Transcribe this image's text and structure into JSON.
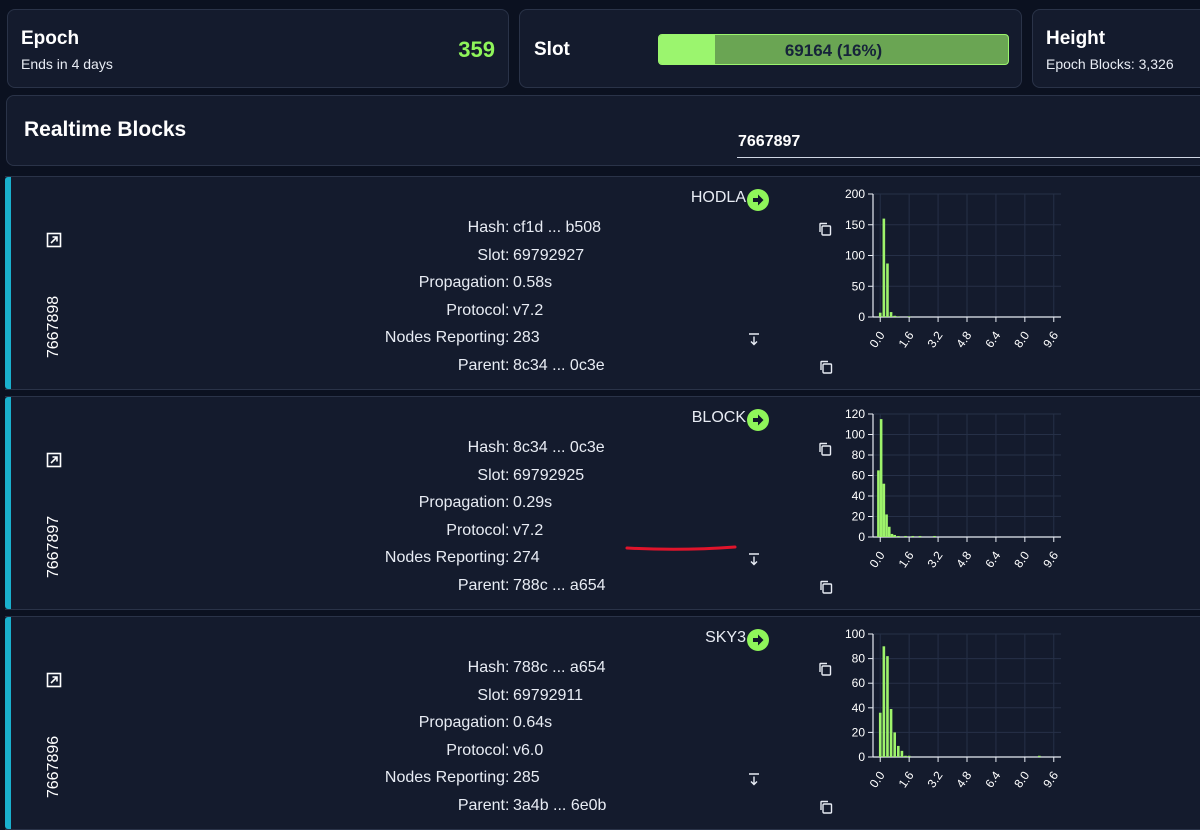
{
  "epoch": {
    "title": "Epoch",
    "subtitle": "Ends in 4 days",
    "value": "359"
  },
  "slot": {
    "title": "Slot",
    "text": "69164 (16%)",
    "progress": 0.16
  },
  "height": {
    "title": "Height",
    "subtitle": "Epoch Blocks: 3,326"
  },
  "realtime": {
    "title": "Realtime Blocks",
    "search_value": "7667897"
  },
  "labels": {
    "hash": "Hash",
    "slot": "Slot",
    "propagation": "Propagation",
    "protocol": "Protocol",
    "nodes": "Nodes Reporting",
    "parent": "Parent",
    "colon": ":"
  },
  "colors": {
    "accent": "#1ab0cd",
    "green": "#8ff55a",
    "bar": "#9ef36b",
    "underline": "#e0142b"
  },
  "icons": {
    "external": "external-link-icon",
    "arrow": "arrow-right-circle-icon",
    "copy": "copy-icon",
    "sort": "sort-down-icon"
  },
  "blocks": [
    {
      "number": "7667898",
      "pool": "HODLA",
      "hash": "cf1d ... b508",
      "slot": "69792927",
      "propagation": "0.58s",
      "protocol": "v7.2",
      "nodes": "283",
      "parent": "8c34 ... 0c3e",
      "chart_data": {
        "type": "bar",
        "x": [
          0.0,
          0.2,
          0.4,
          0.6,
          0.8,
          1.0,
          1.2,
          1.4,
          1.6,
          1.8,
          2.0,
          2.2,
          2.4,
          2.6,
          2.8,
          3.0
        ],
        "values": [
          7,
          160,
          87,
          8,
          2,
          1,
          0,
          0,
          1,
          0,
          0,
          0,
          0,
          0,
          0,
          0
        ],
        "xticks": [
          "0.0",
          "1.6",
          "3.2",
          "4.8",
          "6.4",
          "8.0",
          "9.6"
        ],
        "yticks": [
          "0",
          "50",
          "100",
          "150",
          "200"
        ],
        "ylim": [
          0,
          200
        ],
        "xlim": [
          -0.4,
          10.0
        ]
      }
    },
    {
      "number": "7667897",
      "pool": "BLOCK",
      "hash": "8c34 ... 0c3e",
      "slot": "69792925",
      "propagation": "0.29s",
      "protocol": "v7.2",
      "nodes": "274",
      "parent": "788c ... a654",
      "chart_data": {
        "type": "bar",
        "x": [
          -0.1,
          0.05,
          0.2,
          0.35,
          0.5,
          0.65,
          0.8,
          1.0,
          1.2,
          1.4,
          1.6,
          1.8,
          2.0,
          2.2,
          2.4,
          2.6,
          2.8,
          3.0,
          3.2
        ],
        "values": [
          65,
          115,
          52,
          22,
          10,
          3,
          2,
          1,
          0,
          1,
          0,
          1,
          0,
          1,
          0,
          0,
          0,
          1,
          0
        ],
        "xticks": [
          "0.0",
          "1.6",
          "3.2",
          "4.8",
          "6.4",
          "8.0",
          "9.6"
        ],
        "yticks": [
          "0",
          "20",
          "40",
          "60",
          "80",
          "100",
          "120"
        ],
        "ylim": [
          0,
          120
        ],
        "xlim": [
          -0.4,
          10.0
        ]
      }
    },
    {
      "number": "7667896",
      "pool": "SKY3",
      "hash": "788c ... a654",
      "slot": "69792911",
      "propagation": "0.64s",
      "protocol": "v6.0",
      "nodes": "285",
      "parent": "3a4b ... 6e0b",
      "chart_data": {
        "type": "bar",
        "x": [
          0.0,
          0.2,
          0.4,
          0.6,
          0.8,
          1.0,
          1.2,
          1.4,
          1.6,
          1.8,
          2.0,
          8.8
        ],
        "values": [
          36,
          90,
          82,
          39,
          20,
          9,
          5,
          1,
          1,
          0,
          0,
          1
        ],
        "xticks": [
          "0.0",
          "1.6",
          "3.2",
          "4.8",
          "6.4",
          "8.0",
          "9.6"
        ],
        "yticks": [
          "0",
          "20",
          "40",
          "60",
          "80",
          "100"
        ],
        "ylim": [
          0,
          100
        ],
        "xlim": [
          -0.4,
          10.0
        ]
      }
    }
  ]
}
